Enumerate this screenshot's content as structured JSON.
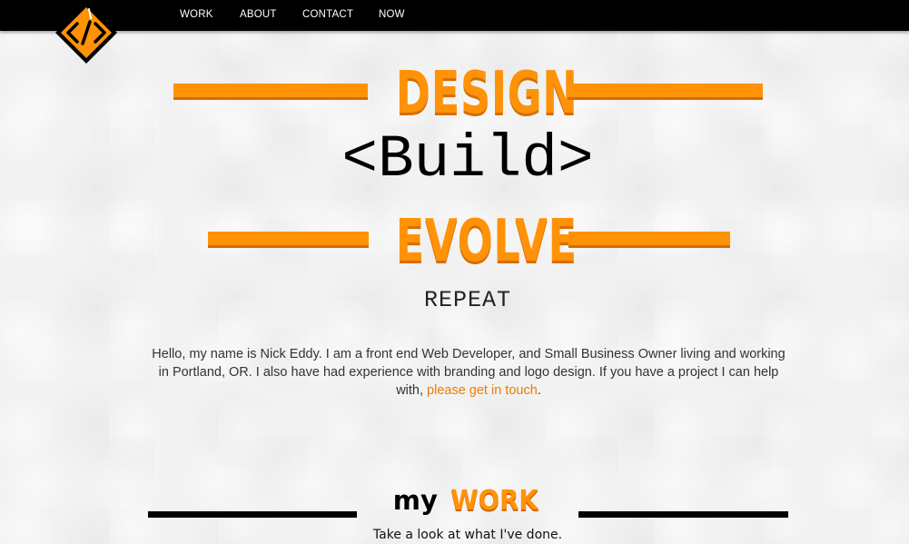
{
  "nav": {
    "items": [
      {
        "label": "WORK"
      },
      {
        "label": "ABOUT"
      },
      {
        "label": "CONTACT"
      },
      {
        "label": "NOW"
      }
    ],
    "logo_icon": "code-brackets-diamond-icon"
  },
  "hero": {
    "line1": "DESIGN",
    "line2": "<Build>",
    "line3": "EVOLVE",
    "line4": "REPEAT"
  },
  "intro": {
    "text": "Hello, my name is Nick Eddy. I am a front end Web Developer, and Small Business Owner living and working in Portland, OR. I also have had experience with branding and logo design. If you have a project I can help with, ",
    "link_text": "please get in touch",
    "trailing": "."
  },
  "work_section": {
    "heading_my": "my",
    "heading_work": "WORK",
    "subtitle": "Take a look at what I've done."
  },
  "colors": {
    "accent": "#ff9207",
    "accent_dark": "#d56d00",
    "link": "#f07b00",
    "nav_bg": "#000000"
  }
}
